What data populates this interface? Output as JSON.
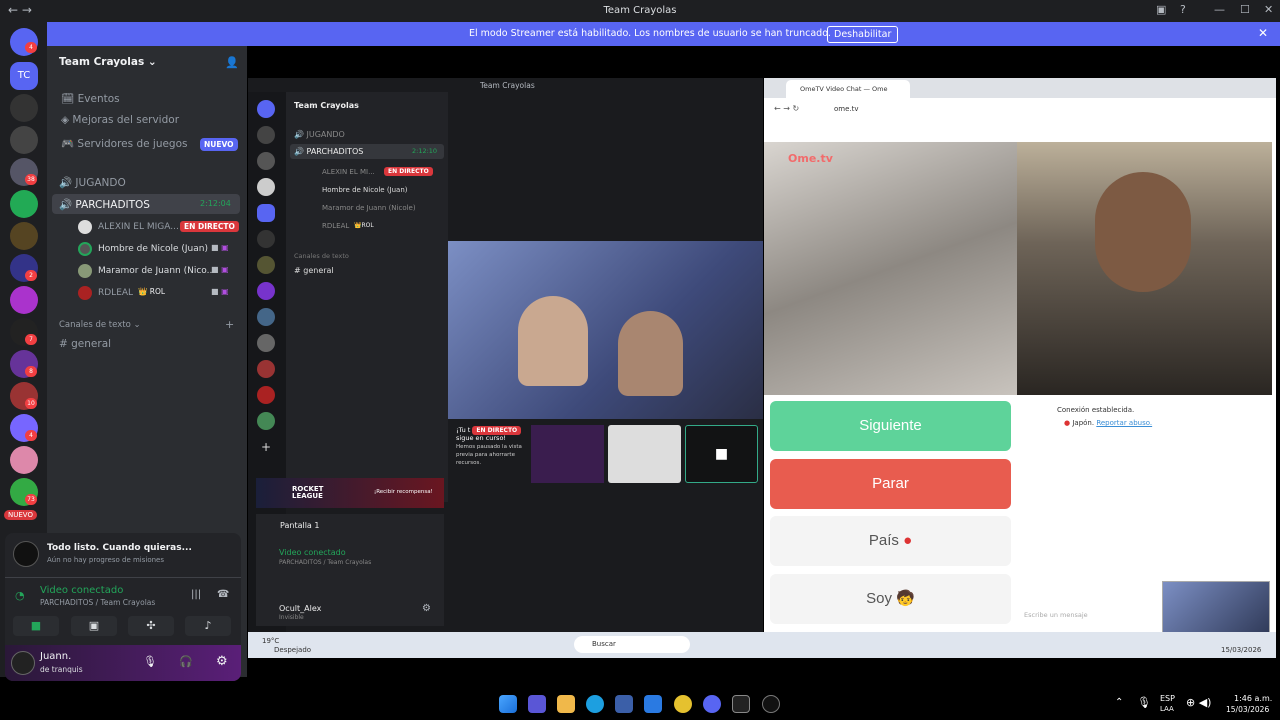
{
  "window": {
    "title": "Team Crayolas"
  },
  "banner": {
    "text": "El modo Streamer está habilitado. Los nombres de usuario se han truncado.",
    "button": "Deshabilitar"
  },
  "rail": {
    "new_badge": "NUEVO",
    "badges": [
      "4",
      "38",
      "2",
      "7",
      "8",
      "10",
      "4",
      "73"
    ]
  },
  "server": {
    "name": "Team Crayolas"
  },
  "sidebar": {
    "items": [
      {
        "label": "Eventos"
      },
      {
        "label": "Mejoras del servidor"
      },
      {
        "label": "Servidores de juegos",
        "badge": "NUEVO"
      }
    ],
    "voice_channels": [
      {
        "name": "JUGANDO"
      },
      {
        "name": "PARCHADITOS",
        "timer": "2:12:04"
      }
    ],
    "voice_users": [
      {
        "name": "ALEXIN EL MIGA...",
        "badge": "EN DIRECTO"
      },
      {
        "name": "Hombre de Nicole (Juan)"
      },
      {
        "name": "Maramor de Juann (Nico..."
      },
      {
        "name": "RDLEAL",
        "role": "ROL"
      }
    ],
    "text_category": "Canales de texto",
    "text_channels": [
      {
        "name": "general"
      }
    ]
  },
  "panel": {
    "notice_title": "Todo listo. Cuando quieras...",
    "notice_sub": "Aún no hay progreso de misiones",
    "voice_status": "Video conectado",
    "voice_location": "PARCHADITOS / Team Crayolas",
    "user_name": "Juann.",
    "user_status": "de tranquis"
  },
  "inner": {
    "title": "Team Crayolas",
    "server": "Team Crayolas",
    "voice": [
      {
        "name": "JUGANDO"
      },
      {
        "name": "PARCHADITOS",
        "timer": "2:12:10"
      }
    ],
    "users": [
      "ALEXIN EL MI...",
      "Hombre de Nicole (Juan)",
      "Maramor de Juann (Nicole)",
      "RDLEAL"
    ],
    "live": "EN DIRECTO",
    "role": "ROL",
    "text_category": "Canales de texto",
    "channel": "general",
    "stream_note_1": "¡Tu t",
    "stream_note_2": "sigue en curso!",
    "stream_note_3": "Hemos pausado la vista previa para ahorrarte recursos.",
    "promo_title": "ROCKET LEAGUE",
    "promo_cta": "¡Recibir recompensa!",
    "screen": "Pantalla 1",
    "voice_status": "Video conectado",
    "voice_location": "PARCHADITOS / Team Crayolas",
    "user": "Ocult_Alex",
    "user_status": "Invisible"
  },
  "browser": {
    "tab": "OmeTV Video Chat — Ome",
    "url": "ome.tv",
    "brand": "Ome.tv",
    "buttons": {
      "next": "Siguiente",
      "stop": "Parar",
      "country": "País",
      "gender": "Soy"
    },
    "chat": {
      "line1": "Conexión establecida.",
      "country": "Japón.",
      "report": "Reportar abuso.",
      "placeholder": "Escribe un mensaje"
    }
  },
  "inner_taskbar": {
    "weather": "19°C",
    "weather_sub": "Despejado",
    "search": "Buscar",
    "date": "15/03/2026"
  },
  "taskbar": {
    "lang": "ESP",
    "lang_sub": "LAA",
    "time": "1:46 a.m.",
    "date": "15/03/2026"
  }
}
